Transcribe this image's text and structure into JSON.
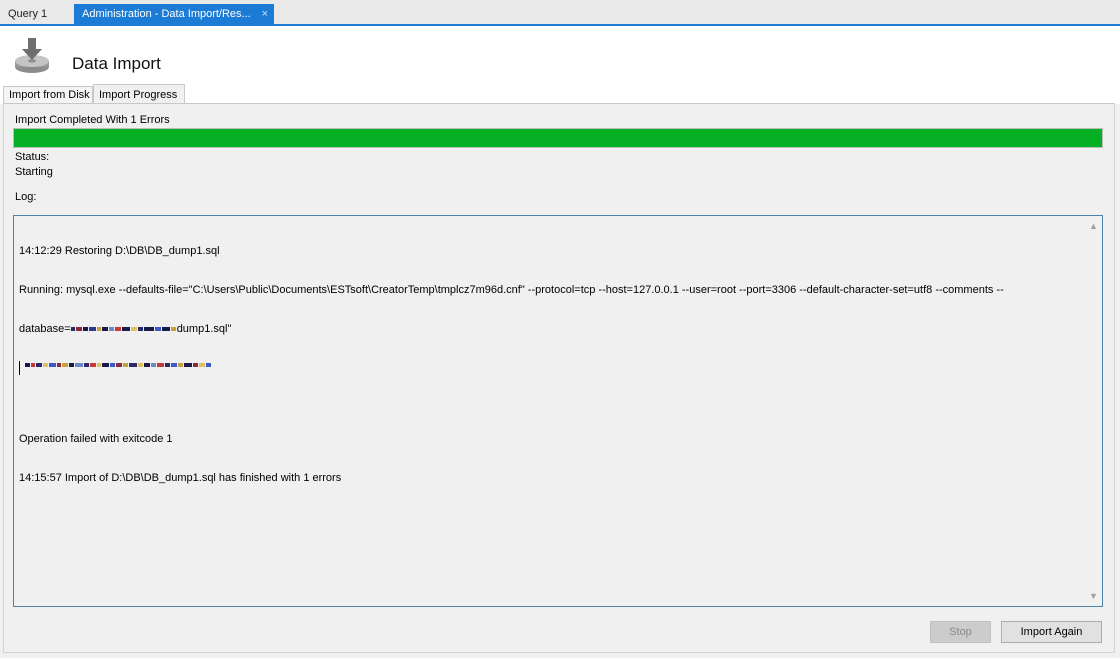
{
  "doc_tabs": {
    "query": "Query 1",
    "admin": "Administration - Data Import/Res...",
    "admin_close": "×"
  },
  "header": {
    "title": "Data Import",
    "icon": "import-disk-icon"
  },
  "sub_tabs": {
    "disk": "Import from Disk",
    "progress": "Import Progress"
  },
  "progress": {
    "message": "Import Completed With 1 Errors",
    "percent": 100,
    "color": "#06b025"
  },
  "status": {
    "label": "Status:",
    "value": "Starting"
  },
  "log": {
    "label": "Log:",
    "line1": "14:12:29 Restoring D:\\DB\\DB_dump1.sql",
    "line2": "Running: mysql.exe --defaults-file=\"C:\\Users\\Public\\Documents\\ESTsoft\\CreatorTemp\\tmplcz7m96d.cnf\"  --protocol=tcp --host=127.0.0.1 --user=root --port=3306 --default-character-set=utf8 --comments --",
    "line3_prefix": "database=",
    "line3_suffix": "dump1.sql\"",
    "line4": "",
    "line5": "Operation failed with exitcode 1",
    "line6": "14:15:57 Import of D:\\DB\\DB_dump1.sql has finished with 1 errors"
  },
  "buttons": {
    "stop": "Stop",
    "import_again": "Import Again"
  }
}
